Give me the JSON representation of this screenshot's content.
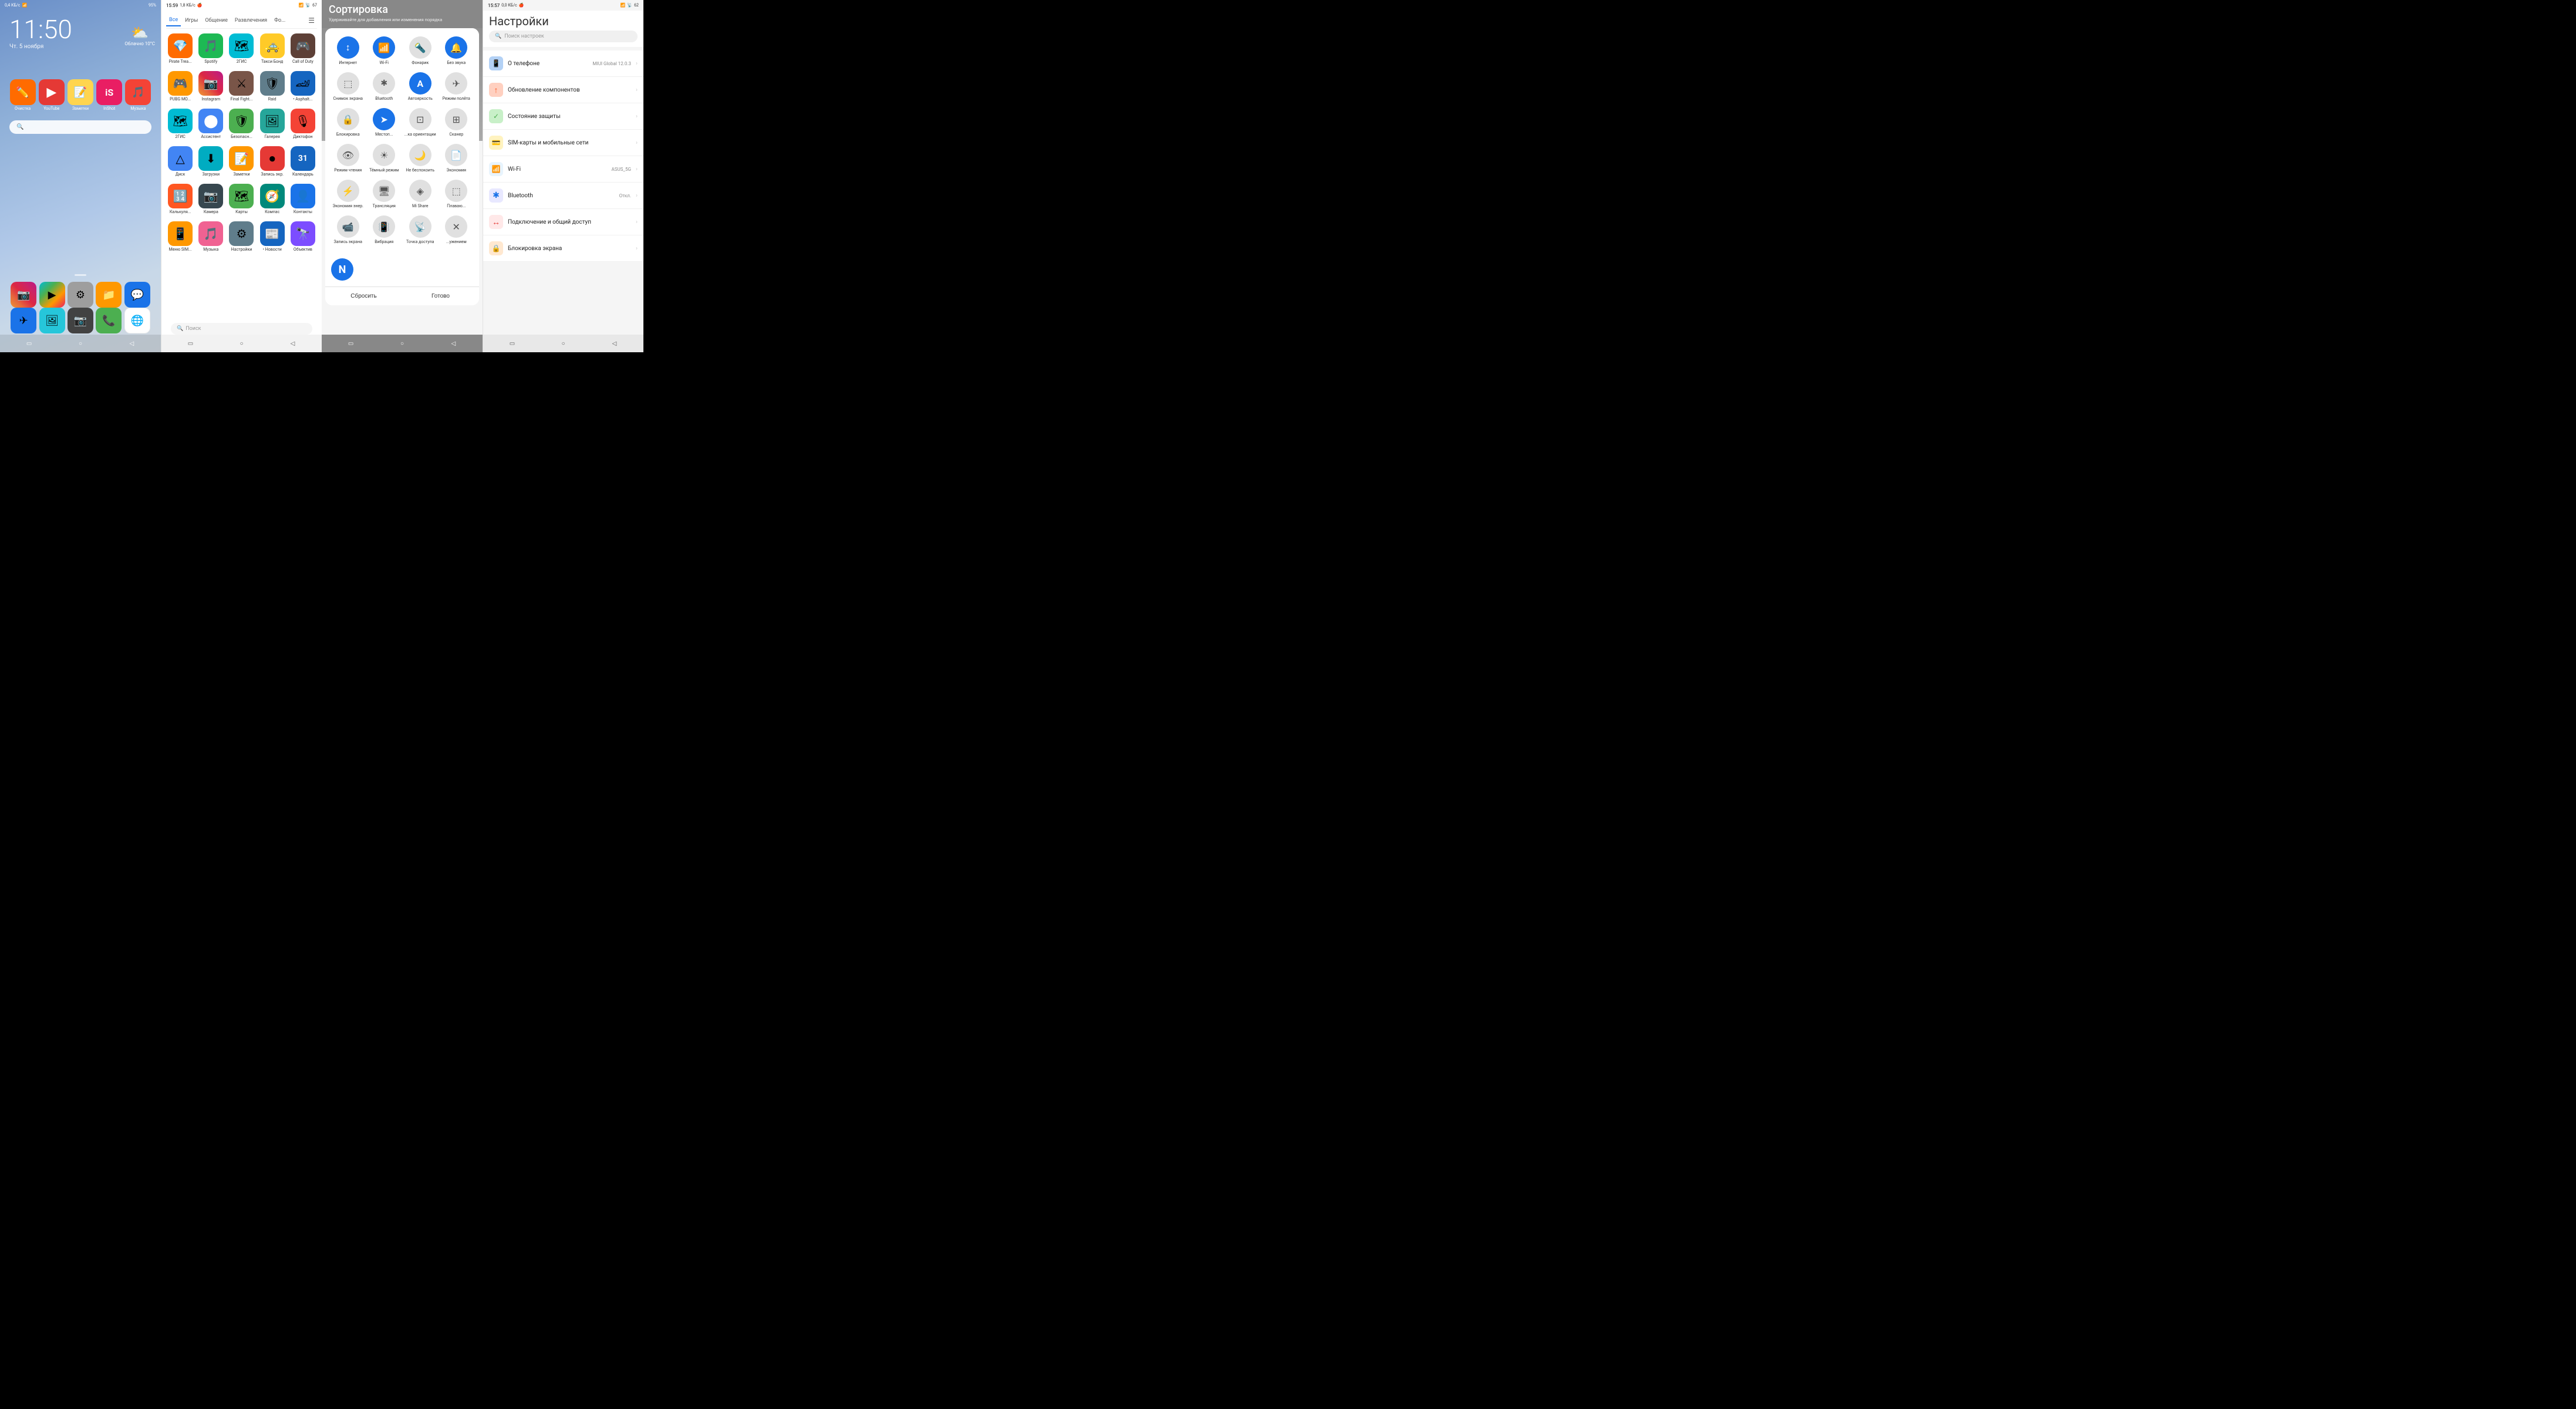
{
  "screen1": {
    "status": {
      "left": "0,4 КБ/с",
      "right": "95%",
      "time": "11:50"
    },
    "time": "11:50",
    "date": "Чт. 5 ноября",
    "weather": {
      "icon": "⛅",
      "text": "Облачно 10°C"
    },
    "apps_row1": [
      {
        "name": "Очистка",
        "bg": "bg-orange",
        "icon": "✏️"
      },
      {
        "name": "YouTube",
        "bg": "bg-red",
        "icon": "▶"
      },
      {
        "name": "Заметки",
        "bg": "bg-yellow-note",
        "icon": "📝"
      },
      {
        "name": "InShot",
        "bg": "bg-pink",
        "icon": "📷"
      },
      {
        "name": "Музыка",
        "bg": "bg-music",
        "icon": "🎵"
      }
    ],
    "search_placeholder": "Поиск",
    "dock": [
      {
        "name": "Instagram",
        "bg": "bg-instagram",
        "icon": "📷"
      },
      {
        "name": "Play Маркет",
        "bg": "bg-playstore",
        "icon": "▶"
      },
      {
        "name": "Настройки",
        "bg": "bg-settings-gray",
        "icon": "⚙"
      },
      {
        "name": "Проводник",
        "bg": "bg-file",
        "icon": "📁"
      },
      {
        "name": "Сообщения",
        "bg": "bg-msg",
        "icon": "💬"
      }
    ],
    "bottom_nav": [
      "▭",
      "○",
      "◁"
    ]
  },
  "screen2": {
    "status": {
      "time": "15:59",
      "data": "1,8 КБ/с"
    },
    "tabs": [
      {
        "label": "Все",
        "active": true
      },
      {
        "label": "Игры",
        "active": false
      },
      {
        "label": "Общение",
        "active": false
      },
      {
        "label": "Развлечения",
        "active": false
      },
      {
        "label": "Фо...",
        "active": false
      }
    ],
    "apps": [
      {
        "name": "Pirate Trea...",
        "bg": "bg-orange",
        "icon": "💎"
      },
      {
        "name": "Spotify",
        "bg": "bg-spotify",
        "icon": "🎵"
      },
      {
        "name": "2ГИС",
        "bg": "bg-green2gis",
        "icon": "🗺"
      },
      {
        "name": "Такси Бонд",
        "bg": "bg-taxi",
        "icon": "🚕"
      },
      {
        "name": "Call of Duty",
        "bg": "bg-cod",
        "icon": "🎮"
      },
      {
        "name": "PUBG MO...",
        "bg": "bg-pubg",
        "icon": "🎮"
      },
      {
        "name": "Instagram",
        "bg": "bg-instagram",
        "icon": "📷"
      },
      {
        "name": "Final Fight...",
        "bg": "bg-final",
        "icon": "⚔"
      },
      {
        "name": "Raid",
        "bg": "bg-raid",
        "icon": "🛡"
      },
      {
        "name": "• Asphalt...",
        "bg": "bg-asphalt",
        "icon": "🏎"
      },
      {
        "name": "2ГИС",
        "bg": "bg-2gis",
        "icon": "🗺"
      },
      {
        "name": "Ассистент",
        "bg": "bg-assistant",
        "icon": "🔵"
      },
      {
        "name": "Безопасн...",
        "bg": "bg-security",
        "icon": "🛡"
      },
      {
        "name": "Галерея",
        "bg": "bg-gallery",
        "icon": "🖼"
      },
      {
        "name": "Диктофон",
        "bg": "bg-recorder",
        "icon": "🎙"
      },
      {
        "name": "Диск",
        "bg": "bg-drive",
        "icon": "△"
      },
      {
        "name": "Загрузки",
        "bg": "bg-download",
        "icon": "⬇"
      },
      {
        "name": "Заметки",
        "bg": "bg-notes",
        "icon": "📝"
      },
      {
        "name": "Запись экр.",
        "bg": "bg-screenrec",
        "icon": "⏺"
      },
      {
        "name": "Календарь",
        "bg": "bg-calendar",
        "icon": "📅"
      },
      {
        "name": "Калькуля...",
        "bg": "bg-calculator",
        "icon": "🔢"
      },
      {
        "name": "Камера",
        "bg": "bg-camera",
        "icon": "📷"
      },
      {
        "name": "Карты",
        "bg": "bg-maps",
        "icon": "🗺"
      },
      {
        "name": "Компас",
        "bg": "bg-compass",
        "icon": "🧭"
      },
      {
        "name": "Контакты",
        "bg": "bg-contacts",
        "icon": "👤"
      },
      {
        "name": "Меню SIM...",
        "bg": "bg-simenu",
        "icon": "📱"
      },
      {
        "name": "Музыка",
        "bg": "bg-music2",
        "icon": "🎵"
      },
      {
        "name": "Настройки",
        "bg": "bg-settings-app",
        "icon": "⚙"
      },
      {
        "name": "• Новости",
        "bg": "bg-news",
        "icon": "📰"
      },
      {
        "name": "Объектив",
        "bg": "bg-obiektif",
        "icon": "🔭"
      }
    ],
    "search_placeholder": "Поиск",
    "bottom_nav": [
      "▭",
      "○",
      "◁"
    ]
  },
  "screen3": {
    "status": {
      "time": ""
    },
    "title": "Сортировка",
    "subtitle": "Удерживайте для добавления или изменения порядка",
    "tiles": [
      {
        "label": "Интернет",
        "icon": "↕",
        "active": true
      },
      {
        "label": "Wi-Fi",
        "icon": "📶",
        "active": true
      },
      {
        "label": "Фонарик",
        "icon": "🔦",
        "active": false
      },
      {
        "label": "Без звука",
        "icon": "🔔",
        "active": true
      },
      {
        "label": "Снимок экрана",
        "icon": "⬚",
        "active": false
      },
      {
        "label": "Bluetooth",
        "icon": "✱",
        "active": false
      },
      {
        "label": "Автояркость",
        "icon": "A",
        "active": true
      },
      {
        "label": "Режим полёта",
        "icon": "✈",
        "active": false
      },
      {
        "label": "Блокировка",
        "icon": "🔒",
        "active": false
      },
      {
        "label": "Местоп...",
        "icon": "➤",
        "active": true
      },
      {
        "label": "...ка ориентации",
        "icon": "⊡",
        "active": false
      },
      {
        "label": "Сканер",
        "icon": "⊞",
        "active": false
      },
      {
        "label": "Режим чтения",
        "icon": "👁",
        "active": false
      },
      {
        "label": "Тёмный режим",
        "icon": "☀",
        "active": false
      },
      {
        "label": "Не беспокоить",
        "icon": "🌙",
        "active": false
      },
      {
        "label": "Экономия",
        "icon": "📄",
        "active": false
      },
      {
        "label": "Экономия энер.",
        "icon": "⚡",
        "active": false
      },
      {
        "label": "Трансляция",
        "icon": "🖥",
        "active": false
      },
      {
        "label": "Mi Share",
        "icon": "◈",
        "active": false
      },
      {
        "label": "Плаваю...",
        "icon": "⬚",
        "active": false
      },
      {
        "label": "Запись экрана",
        "icon": "📹",
        "active": false
      },
      {
        "label": "Вибрация",
        "icon": "📳",
        "active": false
      },
      {
        "label": "Точка доступа",
        "icon": "📡",
        "active": false
      },
      {
        "label": "...ужением",
        "icon": "✕",
        "active": false
      }
    ],
    "extra_tile": {
      "label": "N",
      "bg": "#1a73e8"
    },
    "btn_reset": "Сбросить",
    "btn_done": "Готово",
    "bottom_nav": [
      "▭",
      "○",
      "◁"
    ]
  },
  "screen4": {
    "status": {
      "time": "15:57",
      "data": "0,0 КБ/с"
    },
    "title": "Настройки",
    "search_placeholder": "Поиск настроек",
    "items": [
      {
        "icon": "📱",
        "icon_bg": "#b3d1f5",
        "title": "О телефоне",
        "value": "MIUI Global 12.0.3",
        "color": "#b3d1f5"
      },
      {
        "icon": "↑",
        "icon_bg": "#ffd0c0",
        "title": "Обновление компонентов",
        "value": "",
        "color": "#ff5722"
      },
      {
        "icon": "✓",
        "icon_bg": "#c8f0c8",
        "title": "Состояние защиты",
        "value": "",
        "color": "#4caf50"
      },
      {
        "icon": "💳",
        "icon_bg": "#fff3c0",
        "title": "SIM-карты и мобильные сети",
        "value": "",
        "color": "#ff9800"
      },
      {
        "icon": "📶",
        "icon_bg": "#e8f4fd",
        "title": "Wi-Fi",
        "value": "ASUS_5G",
        "color": "#1a73e8"
      },
      {
        "icon": "✱",
        "icon_bg": "#e8e8ff",
        "title": "Bluetooth",
        "value": "Откл.",
        "color": "#1a73e8"
      },
      {
        "icon": "↔",
        "icon_bg": "#ffe8e8",
        "title": "Подключение и общий доступ",
        "value": "",
        "color": "#e53935"
      },
      {
        "icon": "🔒",
        "icon_bg": "#ffe8d0",
        "title": "Блокировка экрана",
        "value": "",
        "color": "#ff5722"
      }
    ],
    "bottom_nav": [
      "▭",
      "○",
      "◁"
    ]
  }
}
